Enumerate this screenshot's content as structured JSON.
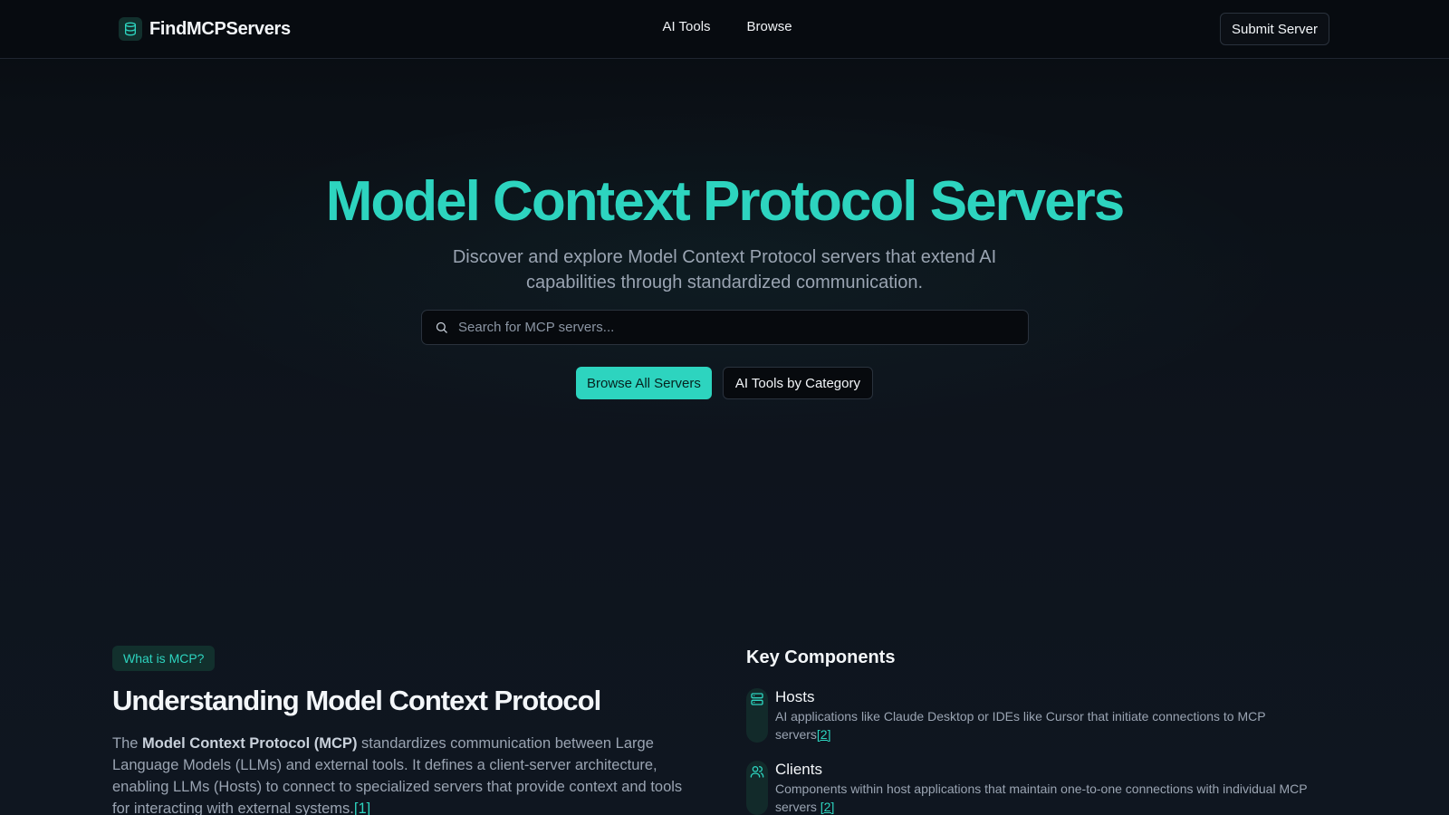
{
  "header": {
    "brand_name": "FindMCPServers",
    "brand_icon": "database-icon",
    "nav": [
      {
        "label": "AI Tools"
      },
      {
        "label": "Browse"
      }
    ],
    "submit_label": "Submit Server"
  },
  "hero": {
    "title": "Model Context Protocol Servers",
    "subtitle": "Discover and explore Model Context Protocol servers that extend AI capabilities through standardized communication.",
    "search": {
      "placeholder": "Search for MCP servers...",
      "value": ""
    },
    "primary_button": "Browse All Servers",
    "secondary_button": "AI Tools by Category"
  },
  "about": {
    "badge": "What is MCP?",
    "title": "Understanding Model Context Protocol",
    "text_prefix": "The ",
    "text_bold": "Model Context Protocol (MCP)",
    "text_body": " standardizes communication between Large Language Models (LLMs) and external tools. It defines a client-server architecture, enabling LLMs (Hosts) to connect to specialized servers that provide context and tools for interacting with external systems.",
    "text_cite": "[1]"
  },
  "key_components": {
    "title": "Key Components",
    "items": [
      {
        "name": "Hosts",
        "icon": "server-icon",
        "description": "AI applications like Claude Desktop or IDEs like Cursor that initiate connections to MCP servers",
        "cite": "[2]"
      },
      {
        "name": "Clients",
        "icon": "users-icon",
        "description": "Components within host applications that maintain one-to-one connections with individual MCP servers ",
        "cite": "[2]"
      }
    ]
  },
  "colors": {
    "accent": "#2dd4bf",
    "background": "#0a0e14",
    "muted_text": "#9aa4b2"
  }
}
